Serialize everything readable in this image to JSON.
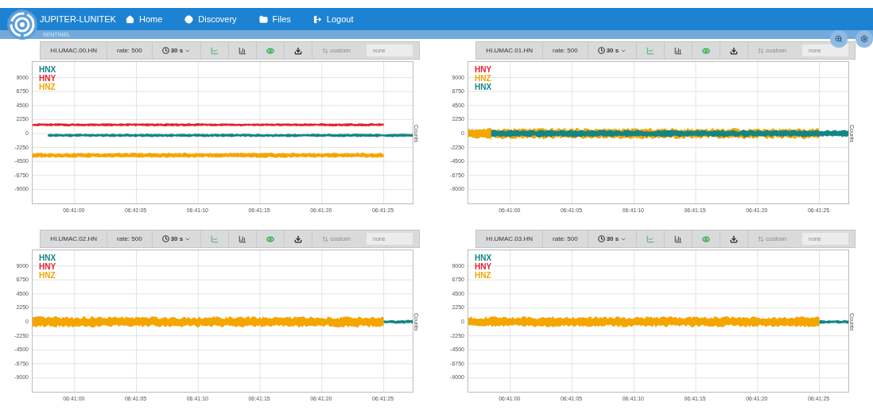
{
  "brand": {
    "name": "JUPITER-LUNITEK",
    "subtitle": "SENTINEL"
  },
  "nav": [
    {
      "label": "Home"
    },
    {
      "label": "Discovery"
    },
    {
      "label": "Files"
    },
    {
      "label": "Logout"
    }
  ],
  "panels": [
    {
      "station": "HI.UMAC.00.HN",
      "rate": "rate: 500",
      "window": "30 s",
      "custom": "custom",
      "custom_placeholder": "none",
      "axis_label": "Counts",
      "y_ticks": [
        "9000",
        "6750",
        "4500",
        "2250",
        "0",
        "-2250",
        "-4500",
        "-6750",
        "-9000"
      ],
      "x_ticks": [
        "06:41:00",
        "06:41:05",
        "06:41:10",
        "06:41:15",
        "06:41:20",
        "06:41:25"
      ],
      "channels": [
        {
          "name": "HNX",
          "color": "#138585",
          "kind": "middle"
        },
        {
          "name": "HNY",
          "color": "#e8202a",
          "kind": "upper"
        },
        {
          "name": "HNZ",
          "color": "#f5a500",
          "kind": "lower"
        }
      ]
    },
    {
      "station": "HI.UMAC.01.HN",
      "rate": "rate: 500",
      "window": "30 s",
      "custom": "custom",
      "custom_placeholder": "none",
      "axis_label": "Counts",
      "y_ticks": [
        "9000",
        "6750",
        "4500",
        "2250",
        "0",
        "-2250",
        "-4500",
        "-6750",
        "-9000"
      ],
      "x_ticks": [
        "06:41:00",
        "06:41:05",
        "06:41:10",
        "06:41:15",
        "06:41:20",
        "06:41:25"
      ],
      "channels": [
        {
          "name": "HNY",
          "color": "#e8202a",
          "kind": "none"
        },
        {
          "name": "HNZ",
          "color": "#f5a500",
          "kind": "wide"
        },
        {
          "name": "HNX",
          "color": "#138585",
          "kind": "dense"
        }
      ]
    },
    {
      "station": "HI.UMAC.02.HN",
      "rate": "rate: 500",
      "window": "30 s",
      "custom": "custom",
      "custom_placeholder": "none",
      "axis_label": "Counts",
      "y_ticks": [
        "9000",
        "6750",
        "4500",
        "2250",
        "0",
        "-2250",
        "-4500",
        "-6750",
        "-9000"
      ],
      "x_ticks": [
        "06:41:00",
        "06:41:05",
        "06:41:10",
        "06:41:15",
        "06:41:20",
        "06:41:25"
      ],
      "channels": [
        {
          "name": "HNX",
          "color": "#138585",
          "kind": "tail"
        },
        {
          "name": "HNY",
          "color": "#e8202a",
          "kind": "none"
        },
        {
          "name": "HNZ",
          "color": "#f5a500",
          "kind": "wide"
        }
      ]
    },
    {
      "station": "HI.UMAC.03.HN",
      "rate": "rate: 500",
      "window": "30 s",
      "custom": "custom",
      "custom_placeholder": "none",
      "axis_label": "Counts",
      "y_ticks": [
        "9000",
        "6750",
        "4500",
        "2250",
        "0",
        "-2250",
        "-4500",
        "-6750",
        "-9000"
      ],
      "x_ticks": [
        "06:41:00",
        "06:41:05",
        "06:41:10",
        "06:41:15",
        "06:41:20",
        "06:41:25"
      ],
      "channels": [
        {
          "name": "HNX",
          "color": "#138585",
          "kind": "tail"
        },
        {
          "name": "HNY",
          "color": "#e8202a",
          "kind": "none"
        },
        {
          "name": "HNZ",
          "color": "#f5a500",
          "kind": "wide"
        }
      ]
    }
  ]
}
